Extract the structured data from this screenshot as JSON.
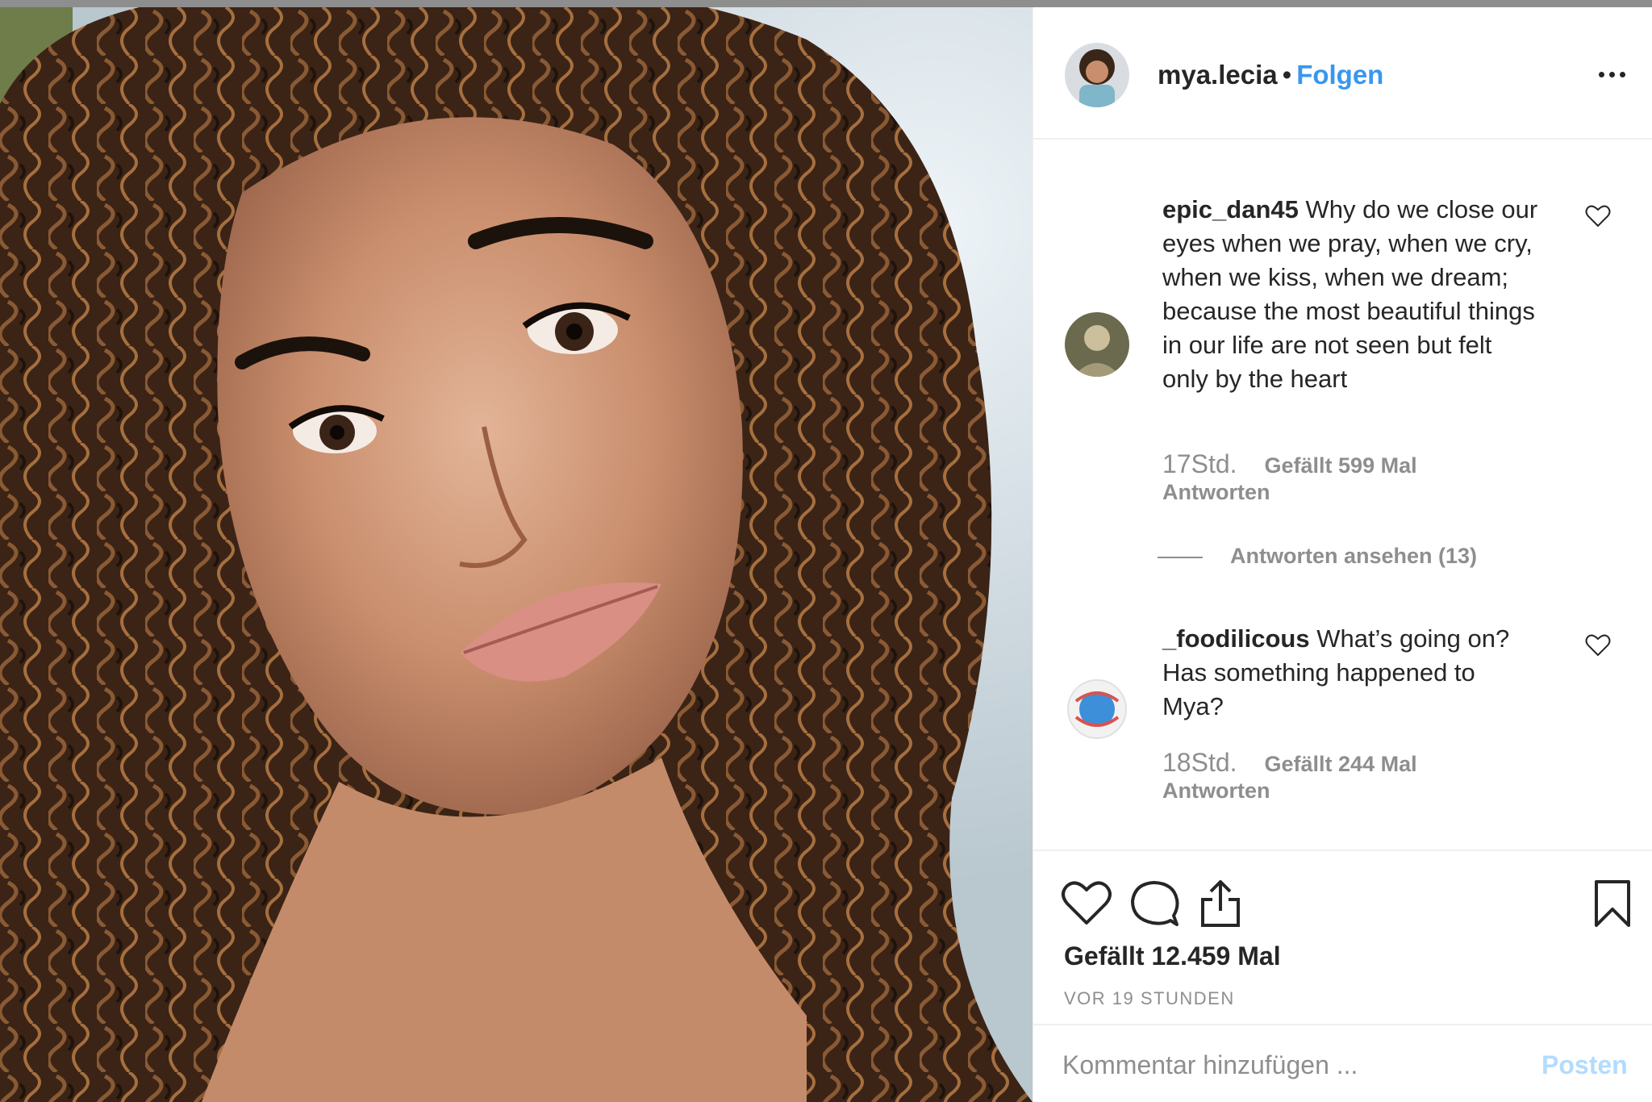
{
  "post": {
    "author": {
      "username": "mya.lecia",
      "separator": "•",
      "follow_label": "Folgen",
      "avatar_icon": "profile-avatar"
    },
    "photo_icon": "portrait-photo",
    "more_icon": "more-options-icon"
  },
  "comments": [
    {
      "username": "epic_dan45",
      "text": "Why do we close our eyes when we pray, when we cry, when we kiss, when we dream; because the most beautiful things in our life are not seen but felt only by the heart",
      "time": "17Std.",
      "likes": "Gefällt 599 Mal",
      "reply_label": "Antworten"
    },
    {
      "username": "_foodilicous",
      "text": "What’s going on? Has something happened to Mya?",
      "time": "18Std.",
      "likes": "Gefällt 244 Mal",
      "reply_label": "Antworten"
    }
  ],
  "view_replies_label": "Antworten ansehen (13)",
  "actions": {
    "like_icon": "heart-icon",
    "comment_icon": "comment-bubble-icon",
    "share_icon": "share-icon",
    "save_icon": "bookmark-icon"
  },
  "likes_count": "Gefällt 12.459 Mal",
  "post_time": "VOR 19 STUNDEN",
  "comment_box": {
    "placeholder": "Kommentar hinzufügen ...",
    "post_label": "Posten"
  },
  "colors": {
    "accent_blue": "#3897f0",
    "post_button_disabled": "#b3dbff",
    "muted_text": "#8e8e8e",
    "primary_text": "#262626"
  }
}
